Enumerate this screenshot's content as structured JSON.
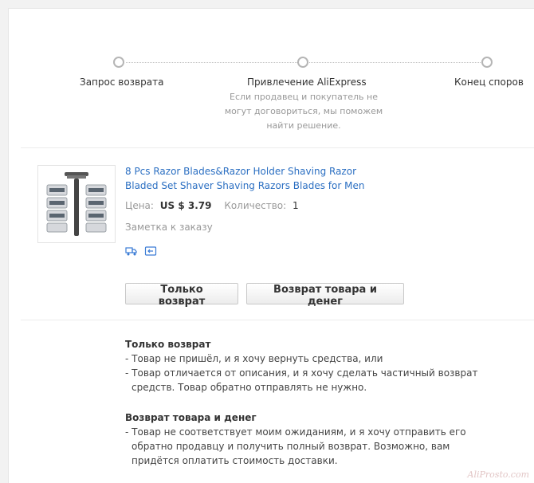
{
  "steps": [
    {
      "label": "Запрос возврата"
    },
    {
      "label": "Привлечение AliExpress",
      "description": "Если продавец и покупатель не могут договориться, мы поможем найти решение."
    },
    {
      "label": "Конец споров"
    }
  ],
  "product": {
    "title_line1": "8 Pcs Razor Blades&Razor Holder Shaving Razor",
    "title_line2": "Bladed Set Shaver Shaving Razors Blades for Men",
    "price_label": "Цена:",
    "price_value": "US $ 3.79",
    "quantity_label": "Количество:",
    "quantity_value": "1",
    "order_note": "Заметка к заказу",
    "icons": [
      "truck-icon",
      "return-icon"
    ]
  },
  "actions": {
    "refund_only": "Только возврат",
    "return_and_refund": "Возврат товара и денег"
  },
  "info": {
    "refund_only": {
      "title": "Только возврат",
      "lines": [
        "- Товар не пришёл, и я хочу вернуть средства, или",
        "- Товар отличается от описания, и я хочу сделать частичный возврат",
        "  средств. Товар обратно отправлять не нужно."
      ]
    },
    "return_and_refund": {
      "title": "Возврат товара и денег",
      "lines": [
        "- Товар не соответствует моим ожиданиям, и я хочу отправить его",
        "  обратно продавцу и получить полный возврат. Возможно, вам",
        "  придётся оплатить стоимость доставки."
      ]
    }
  },
  "watermark": "AliProsto.com",
  "colors": {
    "link": "#2b6fc2",
    "muted": "#999999",
    "icon": "#3a7bd5"
  }
}
